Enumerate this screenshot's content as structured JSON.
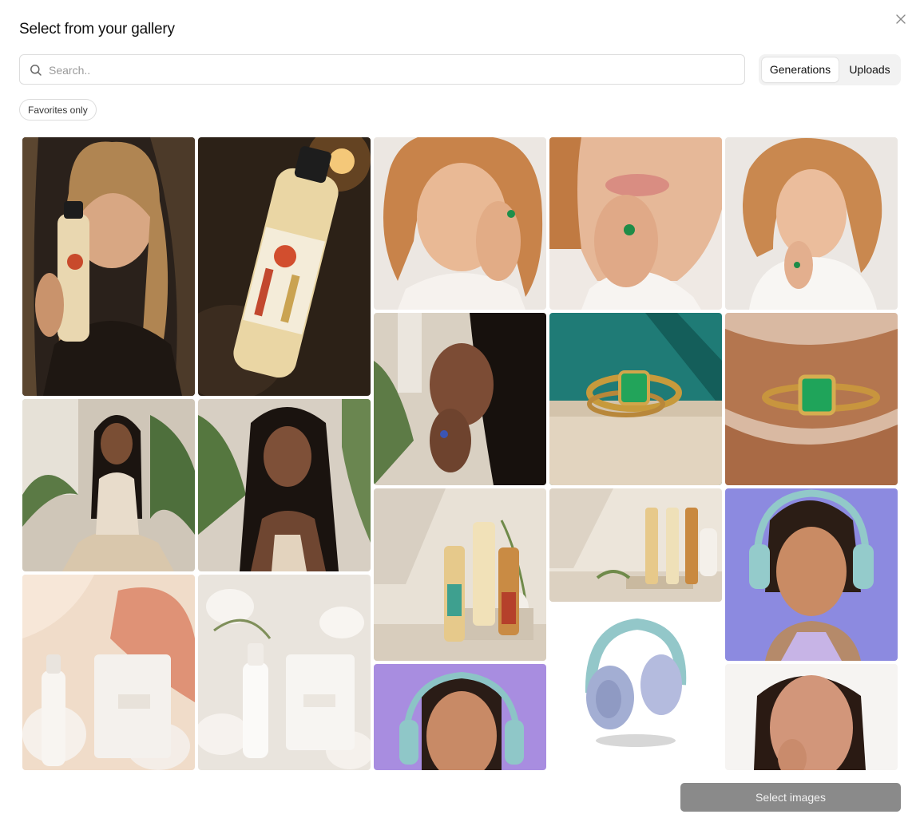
{
  "dialog": {
    "title": "Select from your gallery",
    "close_icon": "close-icon"
  },
  "search": {
    "placeholder": "Search..",
    "value": "",
    "icon": "search-icon"
  },
  "tabs": [
    {
      "label": "Generations",
      "active": true
    },
    {
      "label": "Uploads",
      "active": false
    }
  ],
  "filters": {
    "favorites_label": "Favorites only"
  },
  "gallery": {
    "columns": [
      [
        "woman-with-dressing-bottle",
        "woman-braids-seated-plants",
        "candle-and-spray-bottle-peach"
      ],
      [
        "dressing-bottle-dark-table",
        "woman-braids-smiling-plants",
        "candle-and-spray-bottle-white"
      ],
      [
        "redhead-woman-emerald-ring",
        "woman-braids-profile-ring",
        "three-dressing-bottles-plant",
        "woman-teal-headphones-purple"
      ],
      [
        "closeup-lips-emerald-ring",
        "emerald-ring-on-stone",
        "dressing-bottles-on-tray",
        "teal-headphones-product"
      ],
      [
        "redhead-woman-white-shirt",
        "emerald-ring-on-finger",
        "woman-headphones-lavender",
        "woman-closeup-face-white"
      ]
    ]
  },
  "footer": {
    "select_label": "Select images"
  },
  "colors": {
    "button_disabled": "#8a8a8a",
    "segment_bg": "#f2f2f2",
    "border": "#dcdcdc"
  }
}
